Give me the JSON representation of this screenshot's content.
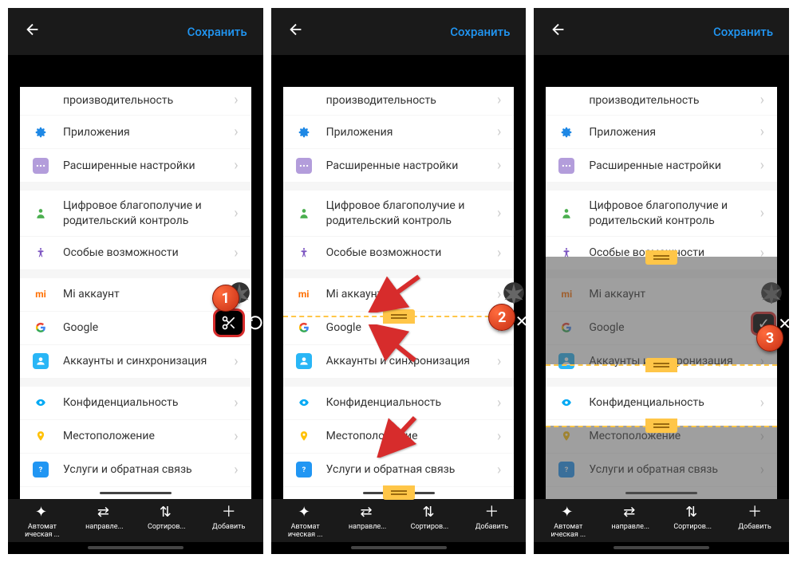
{
  "header": {
    "save": "Сохранить"
  },
  "rows": {
    "performance": "производительность",
    "apps": "Приложения",
    "advanced": "Расширенные настройки",
    "wellbeing": "Цифровое благополучие и родительский контроль",
    "accessibility": "Особые возможности",
    "mi_account": "Mi аккаунт",
    "google": "Google",
    "accounts_sync": "Аккаунты и синхронизация",
    "privacy": "Конфиденциальность",
    "location": "Местоположение",
    "feedback": "Услуги и обратная связь"
  },
  "tools": {
    "auto": "Автомат\nическая ...",
    "direction": "направле...",
    "sort": "Сортиров...",
    "add": "Добавить"
  },
  "callouts": {
    "c1": "1",
    "c2": "2",
    "c3": "3"
  }
}
